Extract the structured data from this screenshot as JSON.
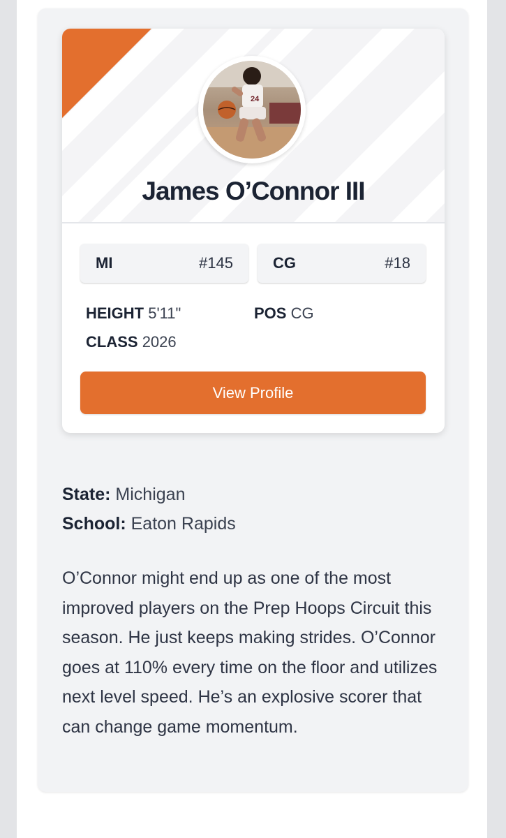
{
  "player": {
    "name": "James O’Connor III",
    "avatar_alt": "player-photo"
  },
  "rankings": {
    "state_label": "MI",
    "state_rank": "#145",
    "position_label": "CG",
    "position_rank": "#18"
  },
  "attributes": {
    "height_label": "HEIGHT",
    "height_value": "5'11\"",
    "pos_label": "POS",
    "pos_value": "CG",
    "class_label": "CLASS",
    "class_value": "2026"
  },
  "actions": {
    "view_profile_label": "View Profile"
  },
  "info": {
    "state_label": "State:",
    "state_value": "Michigan",
    "school_label": "School:",
    "school_value": "Eaton Rapids"
  },
  "description": "O’Connor might end up as one of the most improved players on the Prep Hoops Circuit this season. He just keeps making strides. O’Connor goes at 110% every time on the floor and utilizes next level speed. He’s an explosive scorer that can change game momentum.",
  "colors": {
    "accent": "#e36f2e",
    "text_dark": "#1b2333",
    "card_bg": "#ffffff",
    "panel_bg": "#f2f3f5"
  }
}
